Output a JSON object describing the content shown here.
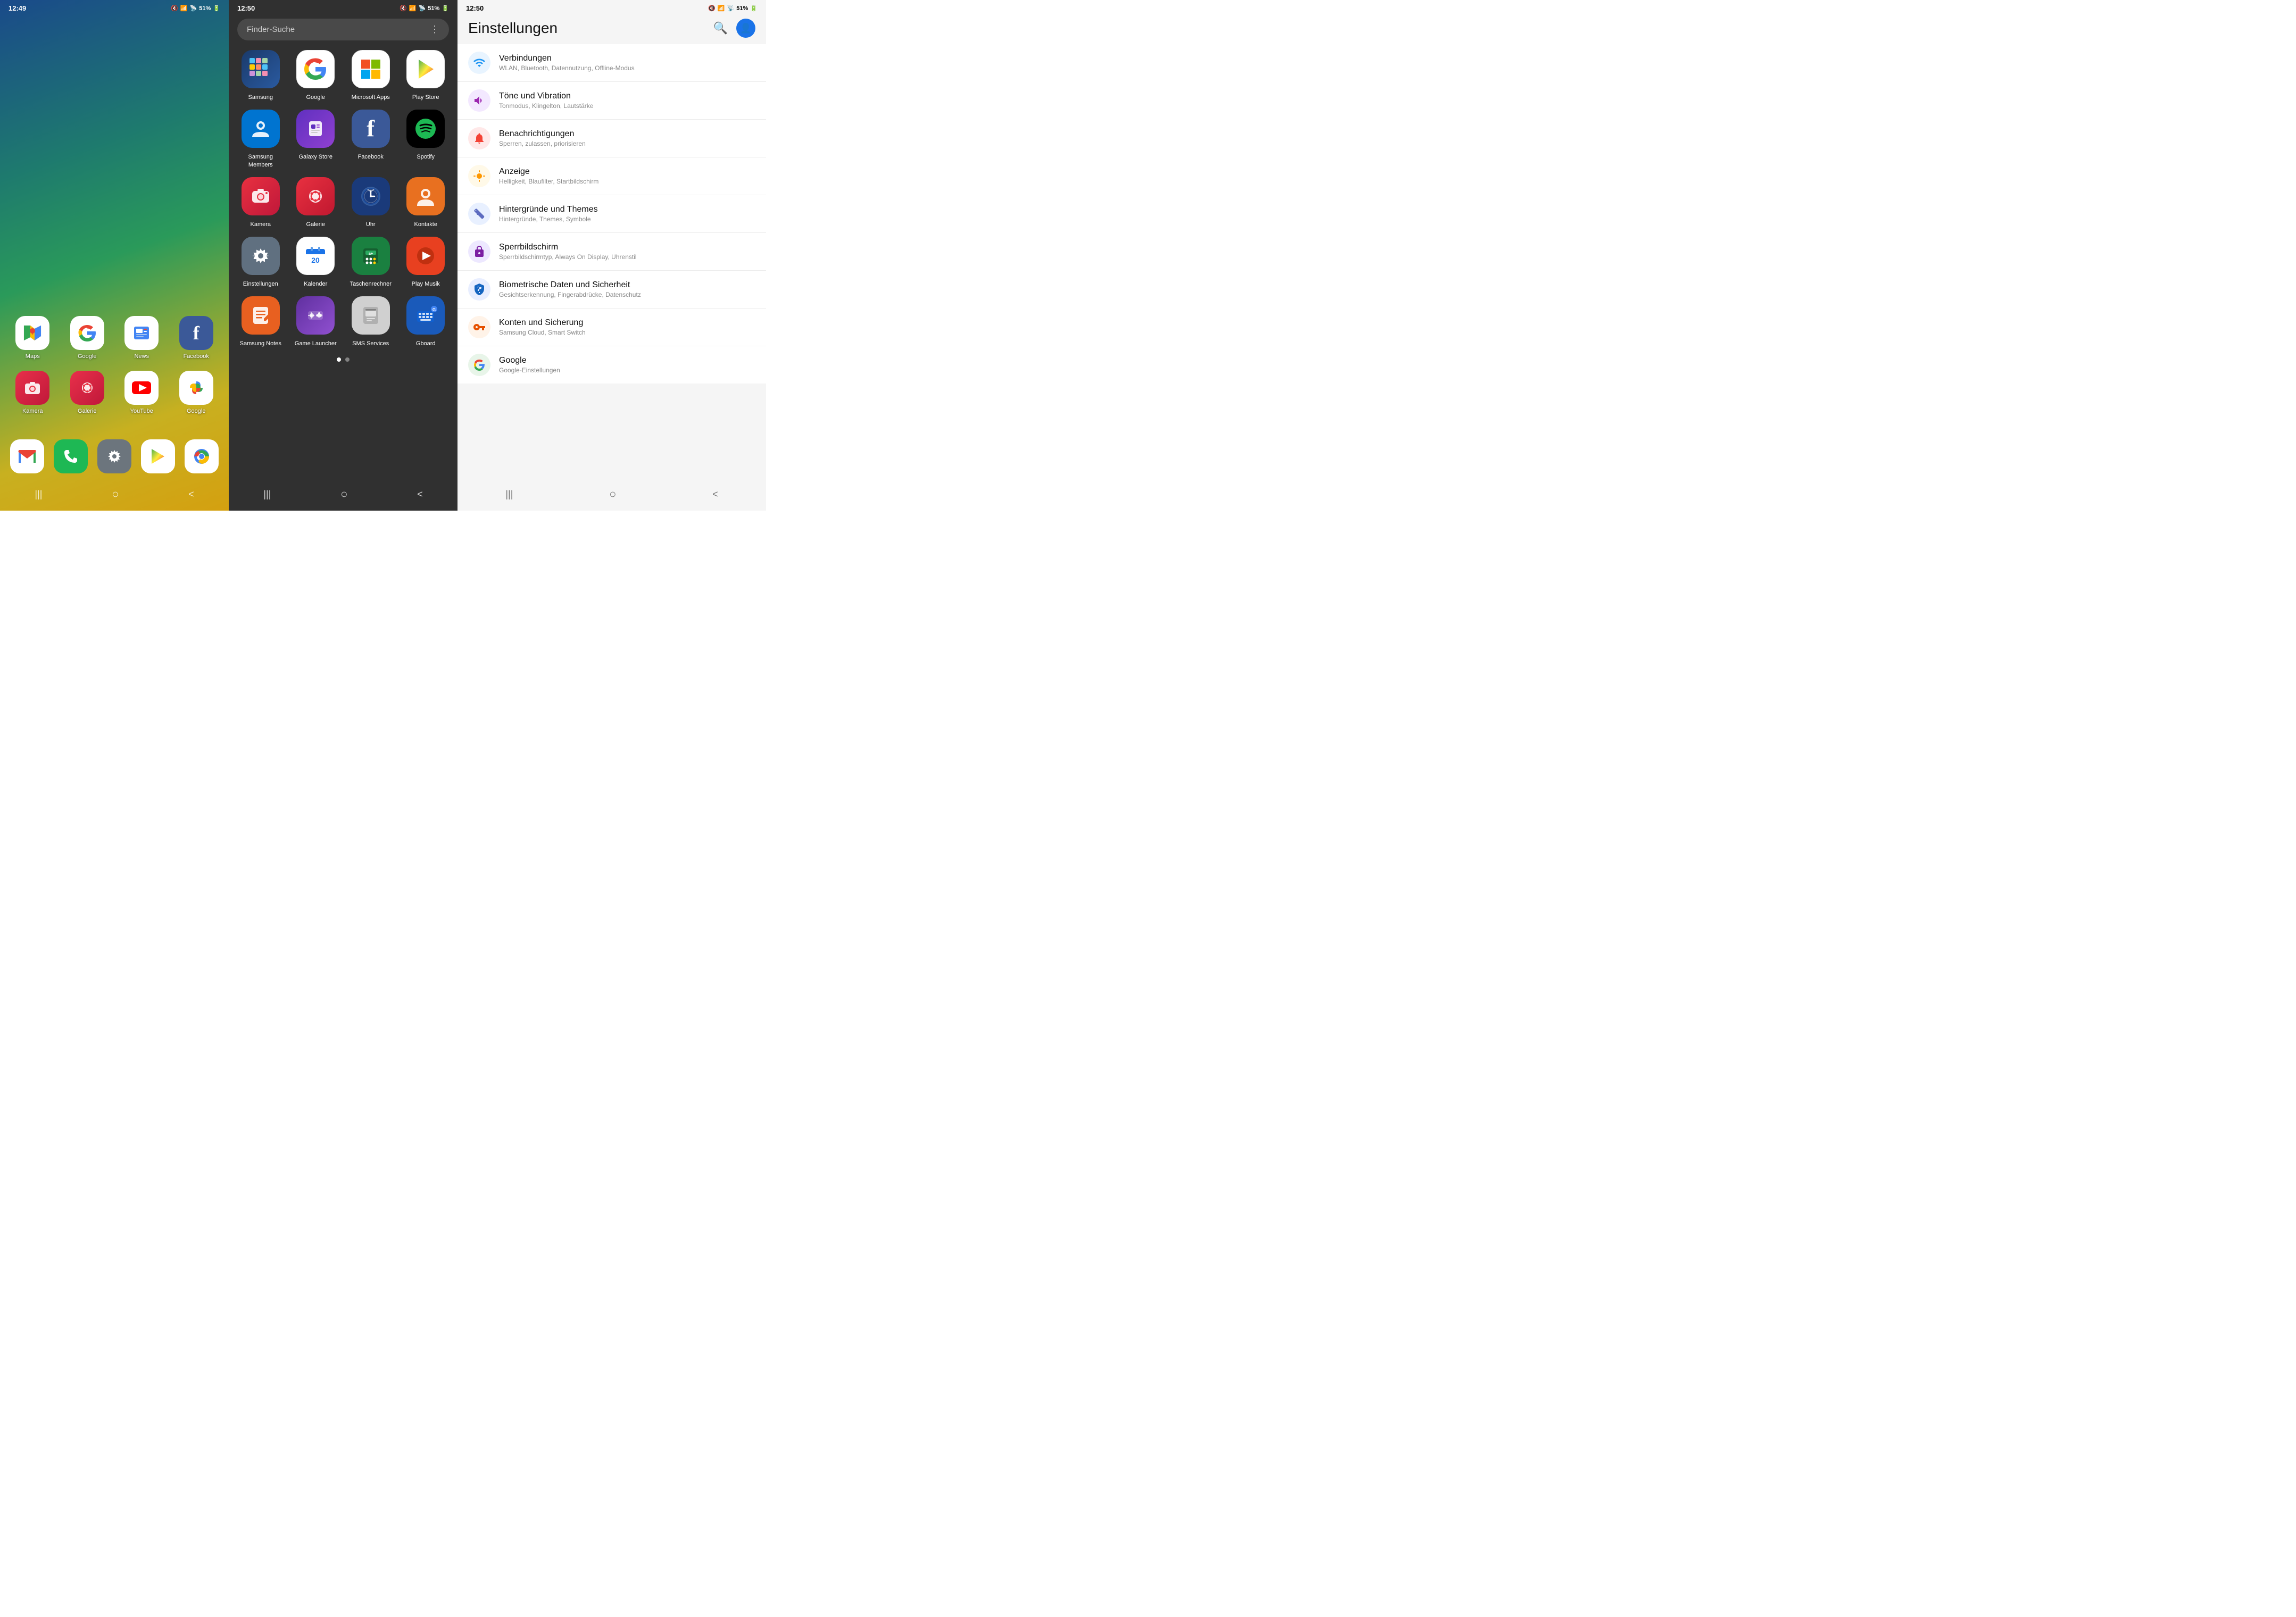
{
  "home": {
    "status": {
      "time": "12:49",
      "battery": "51%"
    },
    "icons": [
      {
        "id": "maps",
        "label": "Maps",
        "bg": "#fff",
        "emoji": "🗺️"
      },
      {
        "id": "google",
        "label": "Google",
        "bg": "#fff",
        "emoji": "G"
      },
      {
        "id": "news",
        "label": "News",
        "bg": "#fff",
        "emoji": "📰"
      },
      {
        "id": "facebook",
        "label": "Facebook",
        "bg": "#3b5998",
        "emoji": "f"
      },
      {
        "id": "kamera",
        "label": "Kamera",
        "bg": "#e83040",
        "emoji": "📷"
      },
      {
        "id": "galerie",
        "label": "Galerie",
        "bg": "#e83040",
        "emoji": "🌸"
      },
      {
        "id": "youtube",
        "label": "YouTube",
        "bg": "#e83040",
        "emoji": "▶"
      },
      {
        "id": "google2",
        "label": "Google",
        "bg": "#fff",
        "emoji": "🎨"
      }
    ],
    "dock": [
      {
        "id": "gmail",
        "label": "",
        "bg": "#fff",
        "emoji": "M"
      },
      {
        "id": "phone",
        "label": "",
        "bg": "#1eb854",
        "emoji": "📞"
      },
      {
        "id": "einstellungen",
        "label": "",
        "bg": "#6c757d",
        "emoji": "⚙️"
      },
      {
        "id": "playstore",
        "label": "",
        "bg": "#fff",
        "emoji": "▶"
      },
      {
        "id": "chrome",
        "label": "",
        "bg": "#fff",
        "emoji": "🌐"
      }
    ],
    "nav": {
      "menu": "|||",
      "home": "○",
      "back": "<"
    }
  },
  "drawer": {
    "status": {
      "time": "12:50",
      "battery": "51%"
    },
    "search_placeholder": "Finder-Suche",
    "icons": [
      {
        "id": "samsung",
        "label": "Samsung",
        "cls": "d-samsung",
        "emoji": "⬢"
      },
      {
        "id": "google",
        "label": "Google",
        "cls": "d-google",
        "emoji": "G"
      },
      {
        "id": "microsoft",
        "label": "Microsoft Apps",
        "cls": "d-ms",
        "emoji": "⊞"
      },
      {
        "id": "playstore",
        "label": "Play Store",
        "cls": "d-playstore",
        "emoji": "▶"
      },
      {
        "id": "members",
        "label": "Samsung Members",
        "cls": "d-members",
        "emoji": "♡"
      },
      {
        "id": "galaxystore",
        "label": "Galaxy Store",
        "cls": "d-galaxystore",
        "emoji": "🛍"
      },
      {
        "id": "facebook",
        "label": "Facebook",
        "cls": "d-facebook",
        "emoji": "f"
      },
      {
        "id": "spotify",
        "label": "Spotify",
        "cls": "d-spotify",
        "emoji": "🎵"
      },
      {
        "id": "kamera",
        "label": "Kamera",
        "cls": "d-kamera",
        "emoji": "📷"
      },
      {
        "id": "galerie",
        "label": "Galerie",
        "cls": "d-galerie",
        "emoji": "🌸"
      },
      {
        "id": "uhr",
        "label": "Uhr",
        "cls": "d-uhr",
        "emoji": "✓"
      },
      {
        "id": "kontakte",
        "label": "Kontakte",
        "cls": "d-kontakte",
        "emoji": "👤"
      },
      {
        "id": "einstellungen",
        "label": "Einstellungen",
        "cls": "d-settings",
        "emoji": "⚙"
      },
      {
        "id": "kalender",
        "label": "Kalender",
        "cls": "d-kalender",
        "emoji": "20"
      },
      {
        "id": "taschenrechner",
        "label": "Taschenrechner",
        "cls": "d-taschenrechner",
        "emoji": "±÷"
      },
      {
        "id": "musik",
        "label": "Play Musik",
        "cls": "d-musik",
        "emoji": "▶"
      },
      {
        "id": "notes",
        "label": "Samsung Notes",
        "cls": "d-notes",
        "emoji": "📝"
      },
      {
        "id": "game",
        "label": "Game Launcher",
        "cls": "d-game",
        "emoji": "⊕×"
      },
      {
        "id": "sms",
        "label": "SMS Services",
        "cls": "d-sms",
        "emoji": "📱"
      },
      {
        "id": "gboard",
        "label": "Gboard",
        "cls": "d-gboard",
        "emoji": "⌨"
      }
    ],
    "dots": [
      {
        "active": true
      },
      {
        "active": false
      }
    ],
    "nav": {
      "menu": "|||",
      "home": "○",
      "back": "<"
    }
  },
  "settings": {
    "status": {
      "time": "12:50",
      "battery": "51%"
    },
    "title": "Einstellungen",
    "items": [
      {
        "id": "verbindungen",
        "title": "Verbindungen",
        "subtitle": "WLAN, Bluetooth, Datennutzung, Offline-Modus",
        "cls": "si-verbindungen",
        "emoji": "📶"
      },
      {
        "id": "toene",
        "title": "Töne und Vibration",
        "subtitle": "Tonmodus, Klingelton, Lautstärke",
        "cls": "si-toene",
        "emoji": "🔉"
      },
      {
        "id": "benachrichtigungen",
        "title": "Benachrichtigungen",
        "subtitle": "Sperren, zulassen, priorisieren",
        "cls": "si-benachrichtigung",
        "emoji": "🔔"
      },
      {
        "id": "anzeige",
        "title": "Anzeige",
        "subtitle": "Helligkeit, Blaufilter, Startbildschirm",
        "cls": "si-anzeige",
        "emoji": "☀"
      },
      {
        "id": "hintergruende",
        "title": "Hintergründe und Themes",
        "subtitle": "Hintergründe, Themes, Symbole",
        "cls": "si-hintergruende",
        "emoji": "🖌"
      },
      {
        "id": "sperrbildschirm",
        "title": "Sperrbildschirm",
        "subtitle": "Sperrbildschirmtyp, Always On Display, Uhrenstil",
        "cls": "si-sperr",
        "emoji": "🔒"
      },
      {
        "id": "biometrie",
        "title": "Biometrische Daten und Sicherheit",
        "subtitle": "Gesichtserkennung, Fingerabdrücke, Datenschutz",
        "cls": "si-biometrie",
        "emoji": "🛡"
      },
      {
        "id": "konten",
        "title": "Konten und Sicherung",
        "subtitle": "Samsung Cloud, Smart Switch",
        "cls": "si-konten",
        "emoji": "🔑"
      },
      {
        "id": "google",
        "title": "Google",
        "subtitle": "Google-Einstellungen",
        "cls": "si-google",
        "emoji": "G"
      }
    ],
    "nav": {
      "menu": "|||",
      "home": "○",
      "back": "<"
    }
  }
}
